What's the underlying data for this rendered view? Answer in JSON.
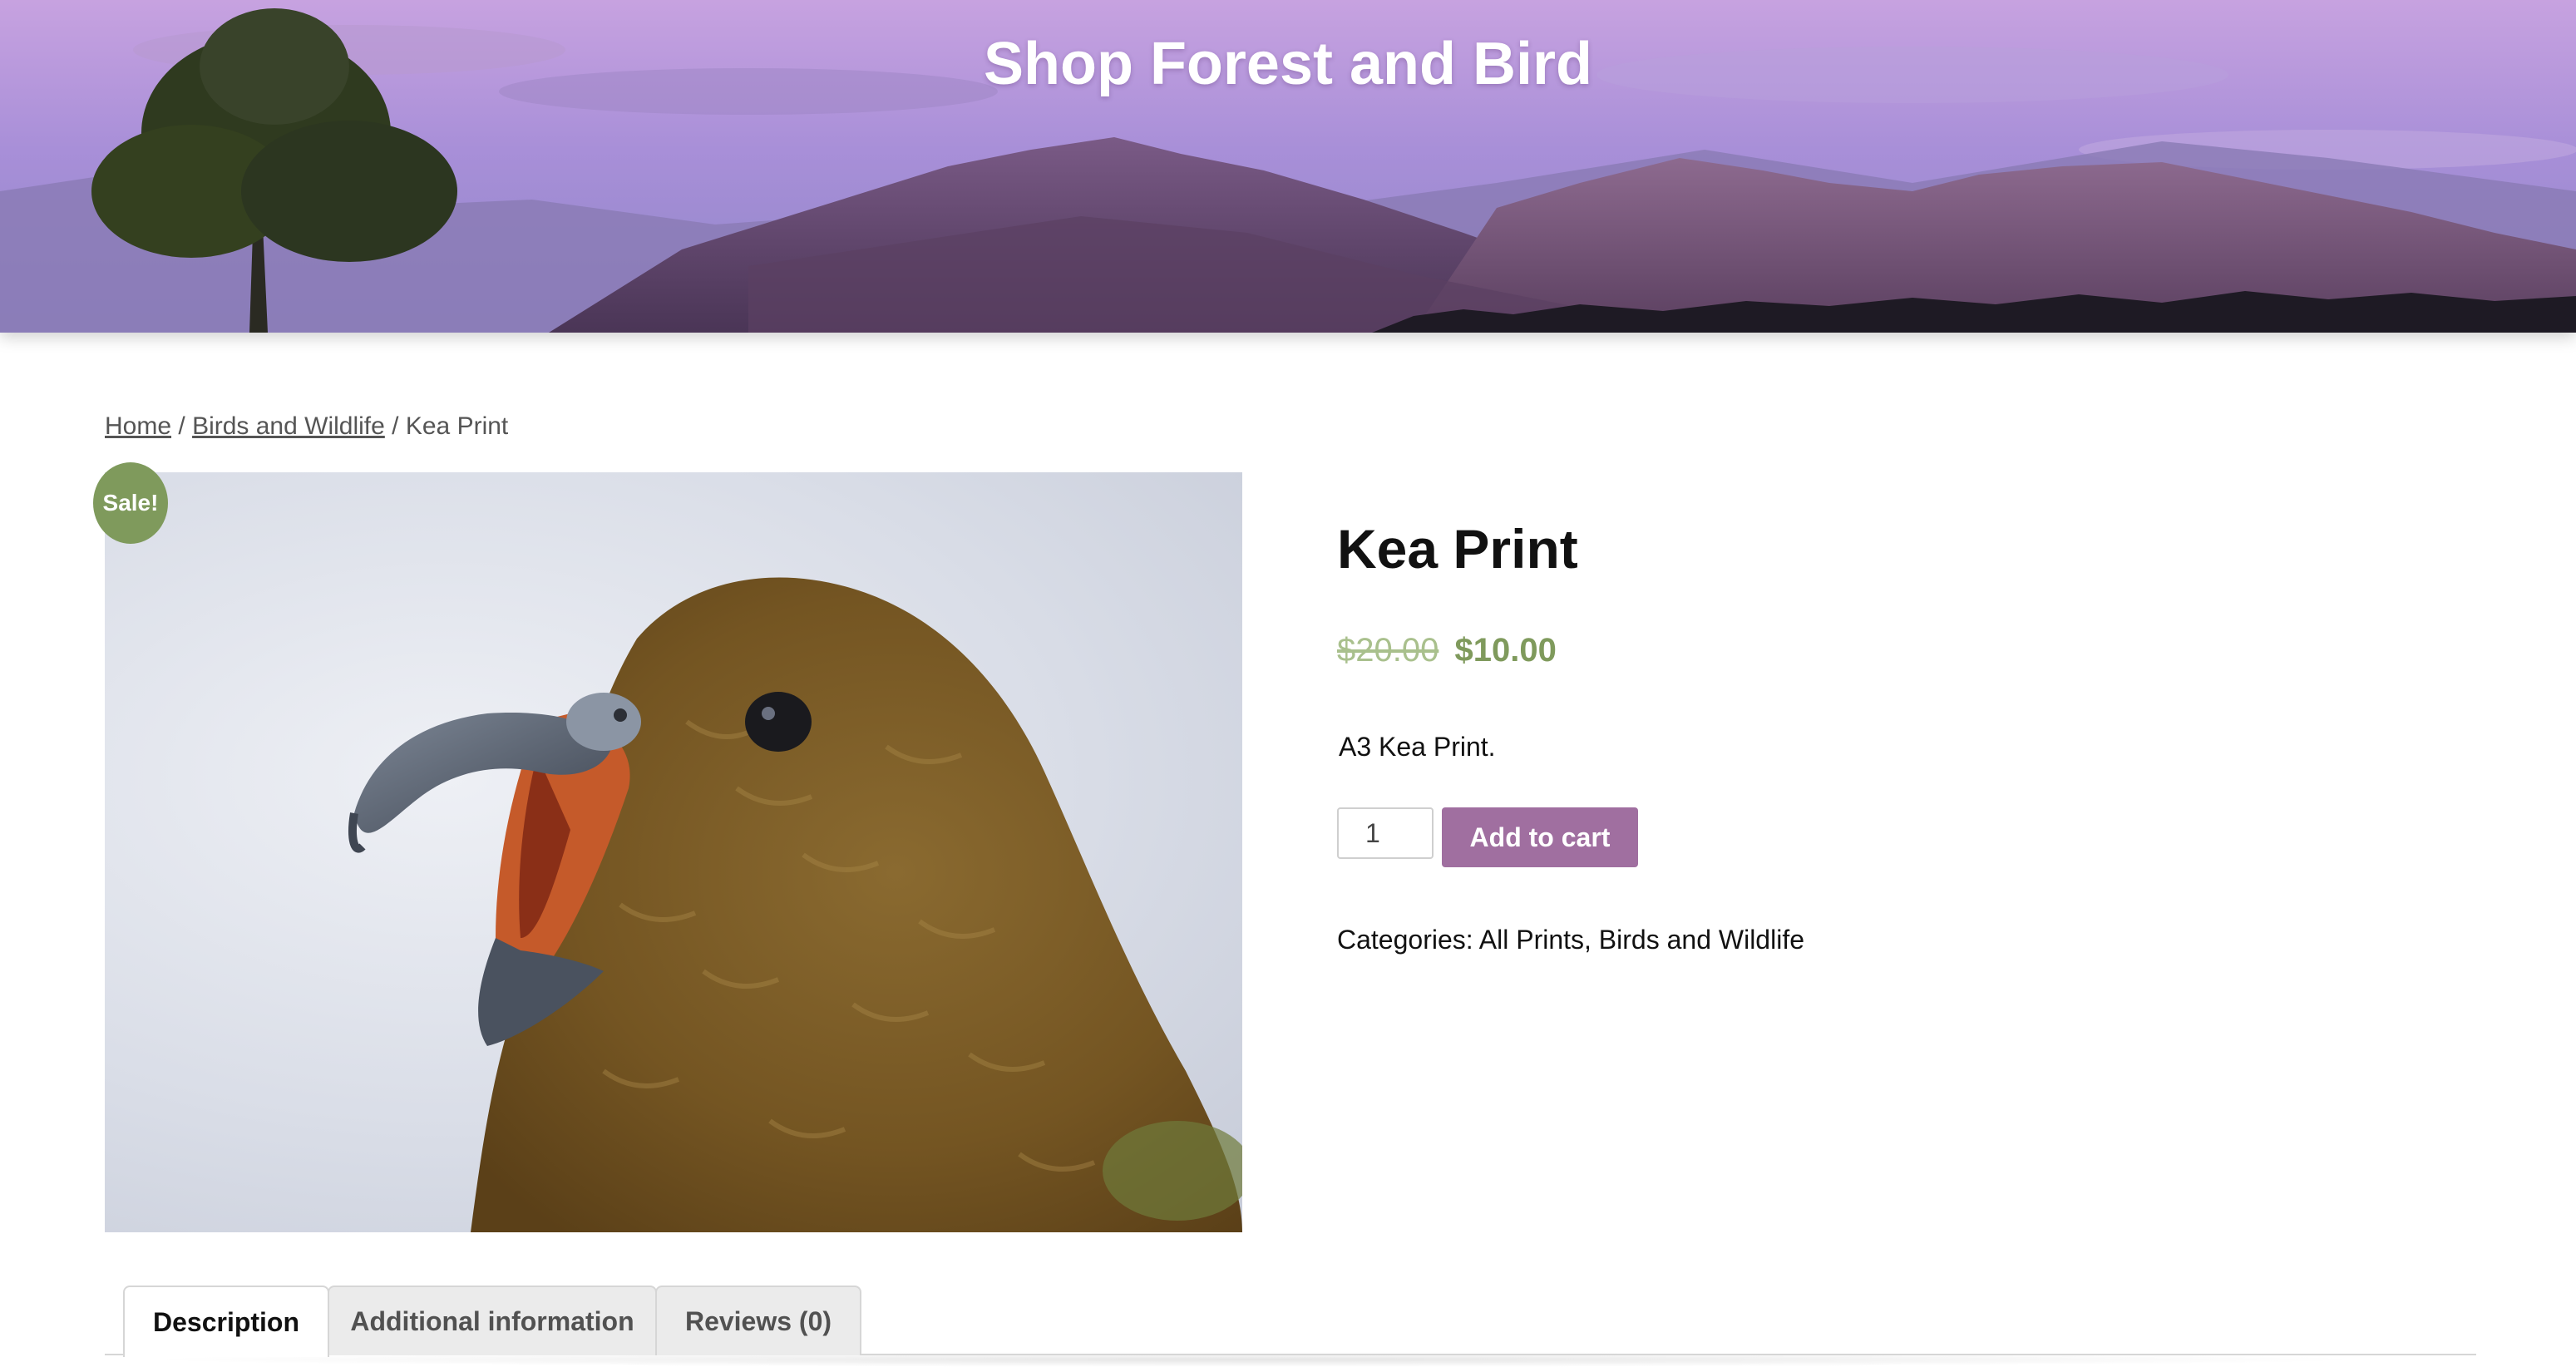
{
  "header": {
    "site_title": "Shop Forest and Bird"
  },
  "breadcrumb": {
    "home": "Home",
    "separator": "/",
    "category": "Birds and Wildlife",
    "current": "Kea Print"
  },
  "product": {
    "sale_badge": "Sale!",
    "title": "Kea Print",
    "price_old": "$20.00",
    "price_new": "$10.00",
    "short_description": "A3 Kea Print.",
    "quantity": "1",
    "add_to_cart_label": "Add to cart",
    "categories_label": "Categories:",
    "categories": [
      "All Prints",
      "Birds and Wildlife"
    ],
    "image_subject": "kea-parrot"
  },
  "tabs": [
    {
      "label": "Description",
      "active": true
    },
    {
      "label": "Additional information",
      "active": false
    },
    {
      "label": "Reviews (0)",
      "active": false
    }
  ],
  "colors": {
    "accent_purple": "#a06fa0",
    "sale_green": "#7f9a5c",
    "old_price_green": "#a9c08d"
  }
}
